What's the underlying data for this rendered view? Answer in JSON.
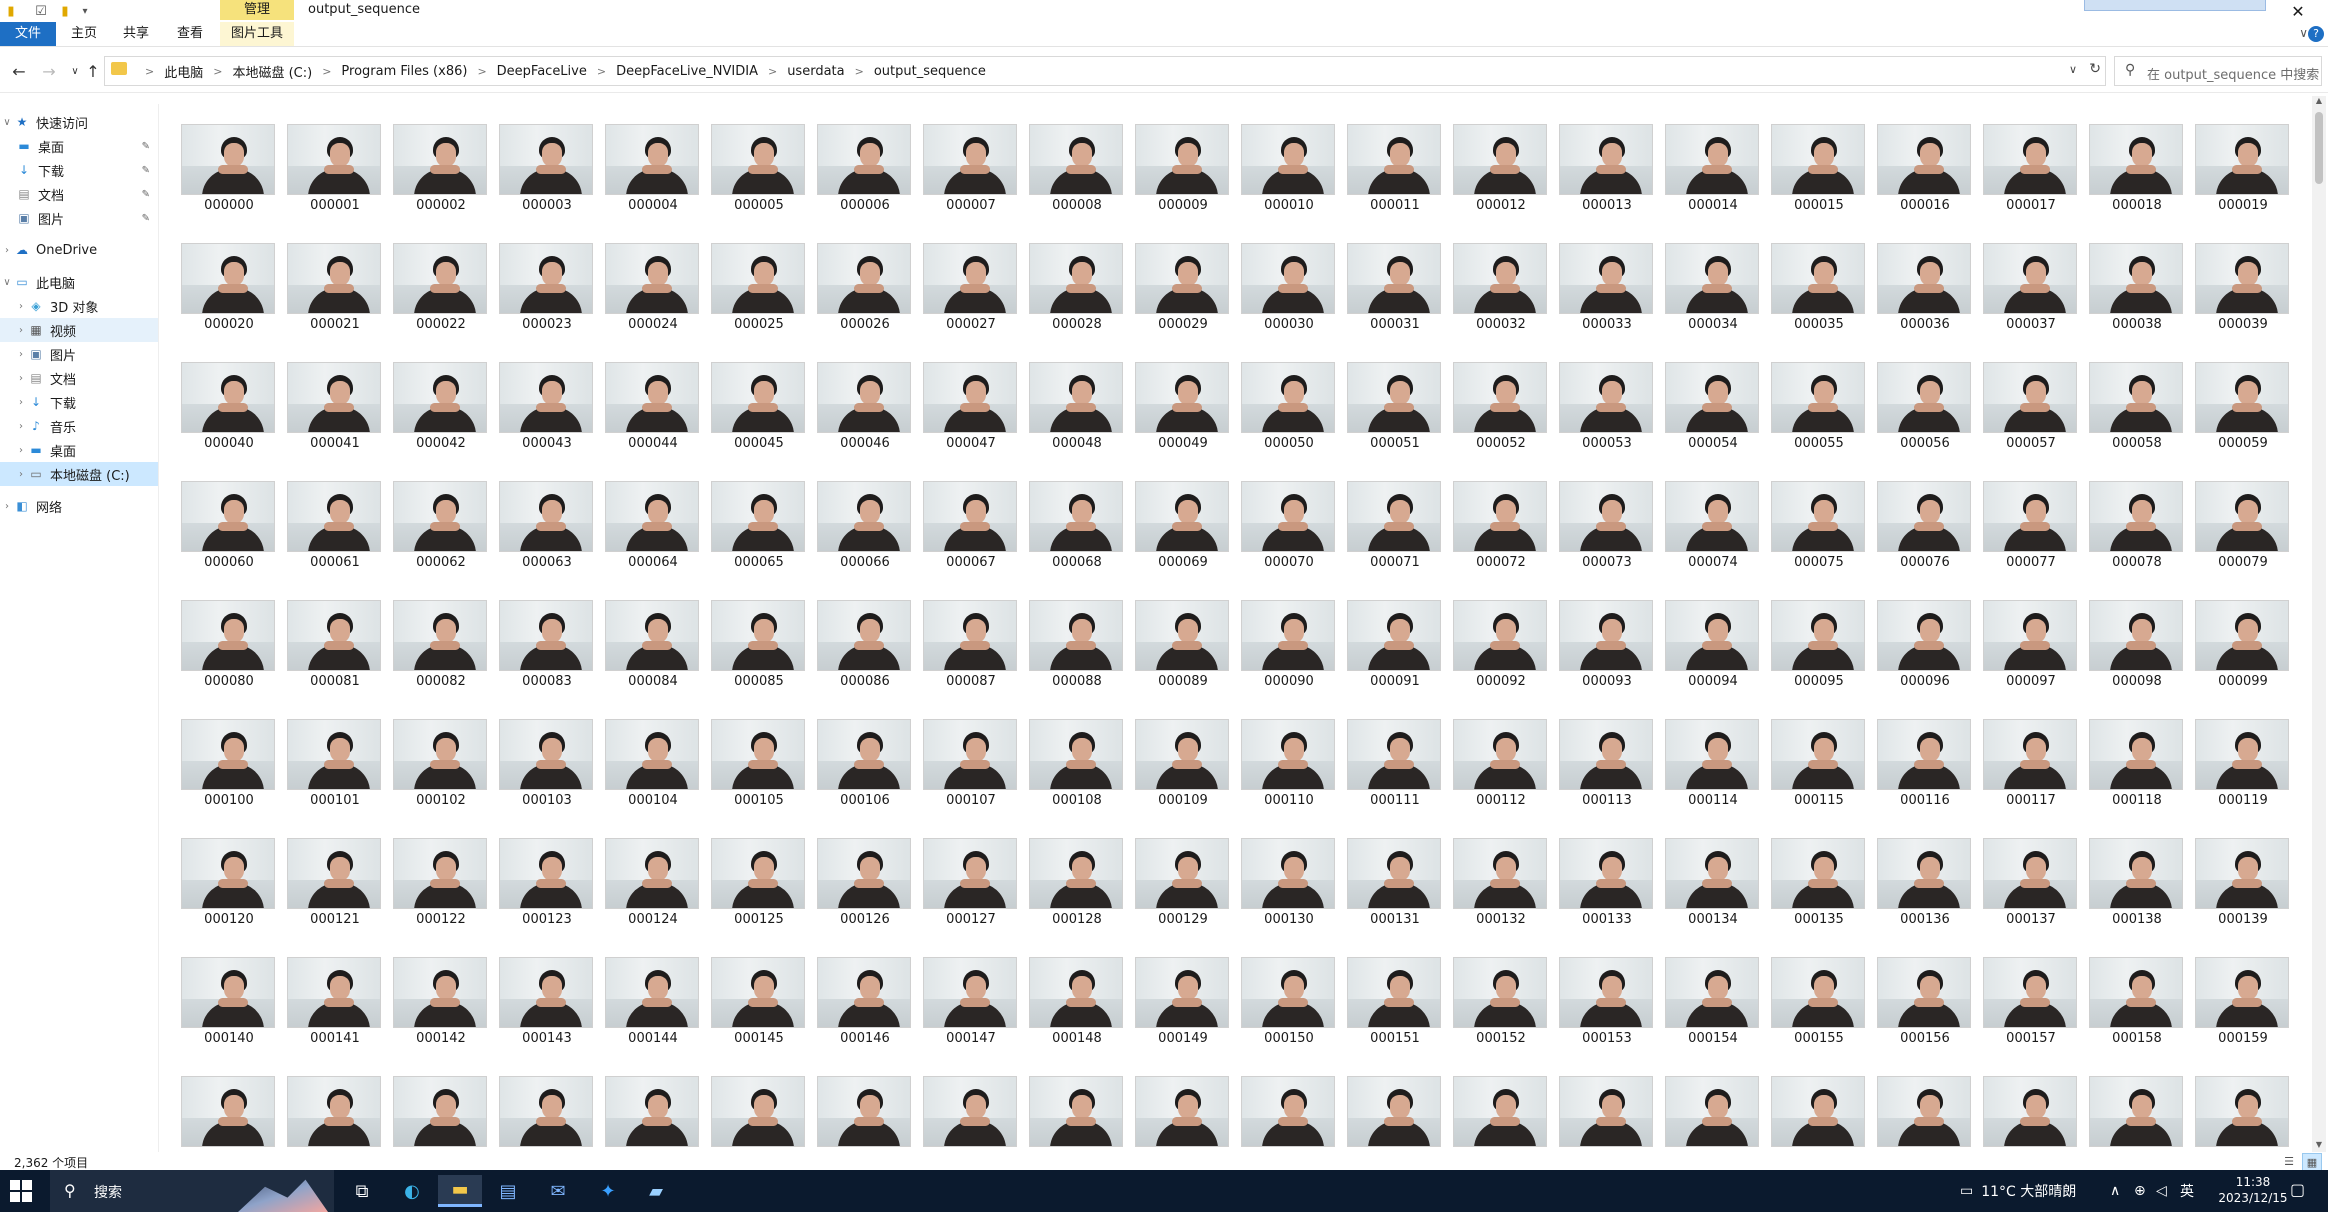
{
  "window": {
    "title": "output_sequence",
    "context_tab": "管理",
    "minimize": "—",
    "close": "✕"
  },
  "ribbon": {
    "tabs": [
      "文件",
      "主页",
      "共享",
      "查看",
      "图片工具"
    ],
    "collapse": "∨",
    "help": "?"
  },
  "address": {
    "crumbs": [
      "此电脑",
      "本地磁盘 (C:)",
      "Program Files (x86)",
      "DeepFaceLive",
      "DeepFaceLive_NVIDIA",
      "userdata",
      "output_sequence"
    ],
    "separator": ">",
    "search_placeholder": "在 output_sequence 中搜索"
  },
  "nav": {
    "items": [
      {
        "label": "快速访问",
        "icon": "★",
        "color": "#1e6fc4"
      },
      {
        "label": "桌面",
        "icon": "▬",
        "color": "#2c8ad8"
      },
      {
        "label": "下载",
        "icon": "↓",
        "color": "#2c8ad8"
      },
      {
        "label": "文档",
        "icon": "▤",
        "color": "#888888"
      },
      {
        "label": "图片",
        "icon": "▣",
        "color": "#5a7fa8"
      },
      {
        "label": "OneDrive",
        "icon": "☁",
        "color": "#1e6fc4"
      },
      {
        "label": "此电脑",
        "icon": "▭",
        "color": "#3a8fd6"
      },
      {
        "label": "3D 对象",
        "icon": "◈",
        "color": "#3aa0d6"
      },
      {
        "label": "视频",
        "icon": "▦",
        "color": "#555555"
      },
      {
        "label": "图片",
        "icon": "▣",
        "color": "#5a7fa8"
      },
      {
        "label": "文档",
        "icon": "▤",
        "color": "#888888"
      },
      {
        "label": "下载",
        "icon": "↓",
        "color": "#2c8ad8"
      },
      {
        "label": "音乐",
        "icon": "♪",
        "color": "#2c8ad8"
      },
      {
        "label": "桌面",
        "icon": "▬",
        "color": "#2c8ad8"
      },
      {
        "label": "本地磁盘 (C:)",
        "icon": "▭",
        "color": "#6b6b6b"
      },
      {
        "label": "网络",
        "icon": "◧",
        "color": "#3a8fd6"
      }
    ],
    "pin": "✎"
  },
  "files": [
    "000000",
    "000001",
    "000002",
    "000003",
    "000004",
    "000005",
    "000006",
    "000007",
    "000008",
    "000009",
    "000010",
    "000011",
    "000012",
    "000013",
    "000014",
    "000015",
    "000016",
    "000017",
    "000018",
    "000019",
    "000020",
    "000021",
    "000022",
    "000023",
    "000024",
    "000025",
    "000026",
    "000027",
    "000028",
    "000029",
    "000030",
    "000031",
    "000032",
    "000033",
    "000034",
    "000035",
    "000036",
    "000037",
    "000038",
    "000039",
    "000040",
    "000041",
    "000042",
    "000043",
    "000044",
    "000045",
    "000046",
    "000047",
    "000048",
    "000049",
    "000050",
    "000051",
    "000052",
    "000053",
    "000054",
    "000055",
    "000056",
    "000057",
    "000058",
    "000059",
    "000060",
    "000061",
    "000062",
    "000063",
    "000064",
    "000065",
    "000066",
    "000067",
    "000068",
    "000069",
    "000070",
    "000071",
    "000072",
    "000073",
    "000074",
    "000075",
    "000076",
    "000077",
    "000078",
    "000079",
    "000080",
    "000081",
    "000082",
    "000083",
    "000084",
    "000085",
    "000086",
    "000087",
    "000088",
    "000089",
    "000090",
    "000091",
    "000092",
    "000093",
    "000094",
    "000095",
    "000096",
    "000097",
    "000098",
    "000099",
    "000100",
    "000101",
    "000102",
    "000103",
    "000104",
    "000105",
    "000106",
    "000107",
    "000108",
    "000109",
    "000110",
    "000111",
    "000112",
    "000113",
    "000114",
    "000115",
    "000116",
    "000117",
    "000118",
    "000119",
    "000120",
    "000121",
    "000122",
    "000123",
    "000124",
    "000125",
    "000126",
    "000127",
    "000128",
    "000129",
    "000130",
    "000131",
    "000132",
    "000133",
    "000134",
    "000135",
    "000136",
    "000137",
    "000138",
    "000139",
    "000140",
    "000141",
    "000142",
    "000143",
    "000144",
    "000145",
    "000146",
    "000147",
    "000148",
    "000149",
    "000150",
    "000151",
    "000152",
    "000153",
    "000154",
    "000155",
    "000156",
    "000157",
    "000158",
    "000159",
    "",
    "",
    "",
    "",
    "",
    "",
    "",
    "",
    "",
    "",
    "",
    "",
    "",
    "",
    "",
    "",
    "",
    "",
    "",
    ""
  ],
  "status": {
    "item_count": "2,362 个项目"
  },
  "taskbar": {
    "search_label": "搜索",
    "weather": "11°C  大部晴朗",
    "ime": "英",
    "time": "11:38",
    "date": "2023/12/15"
  }
}
